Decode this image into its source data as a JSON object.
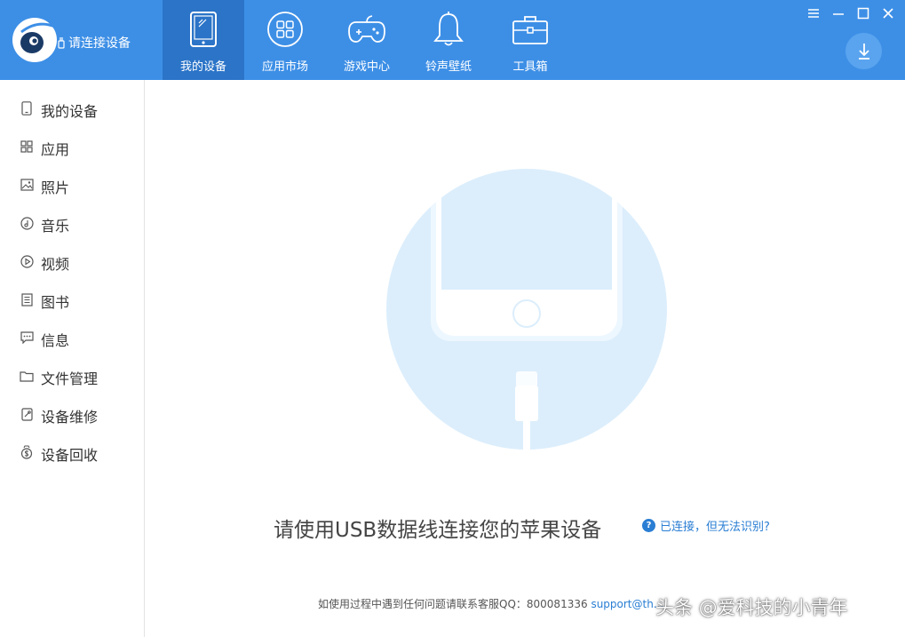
{
  "app": {
    "device_status": "请连接设备"
  },
  "nav": {
    "tabs": [
      {
        "label": "我的设备",
        "icon": "tablet-icon",
        "active": true
      },
      {
        "label": "应用市场",
        "icon": "app-grid-icon",
        "active": false
      },
      {
        "label": "游戏中心",
        "icon": "gamepad-icon",
        "active": false
      },
      {
        "label": "铃声壁纸",
        "icon": "bell-icon",
        "active": false
      },
      {
        "label": "工具箱",
        "icon": "toolbox-icon",
        "active": false
      }
    ]
  },
  "window_controls": [
    "menu-icon",
    "minimize-icon",
    "maximize-icon",
    "close-icon"
  ],
  "sidebar": {
    "items": [
      {
        "label": "我的设备",
        "icon": "phone-icon"
      },
      {
        "label": "应用",
        "icon": "grid-icon"
      },
      {
        "label": "照片",
        "icon": "image-icon"
      },
      {
        "label": "音乐",
        "icon": "music-icon"
      },
      {
        "label": "视频",
        "icon": "play-icon"
      },
      {
        "label": "图书",
        "icon": "book-icon"
      },
      {
        "label": "信息",
        "icon": "message-icon"
      },
      {
        "label": "文件管理",
        "icon": "folder-icon"
      },
      {
        "label": "设备维修",
        "icon": "repair-icon"
      },
      {
        "label": "设备回收",
        "icon": "recycle-money-icon"
      }
    ]
  },
  "main": {
    "connect_prompt": "请使用USB数据线连接您的苹果设备",
    "help_link": "已连接，但无法识别?",
    "help_icon_glyph": "?",
    "footer_text": "如使用过程中遇到任何问题请联系客服QQ：800081336",
    "footer_email": "support@th..."
  },
  "watermark": "头条 @爱科技的小青年",
  "colors": {
    "topbar": "#3d8fe6",
    "active_tab": "#2b74c8",
    "link": "#2a7ed3",
    "illustration_circle": "#dceefc"
  }
}
